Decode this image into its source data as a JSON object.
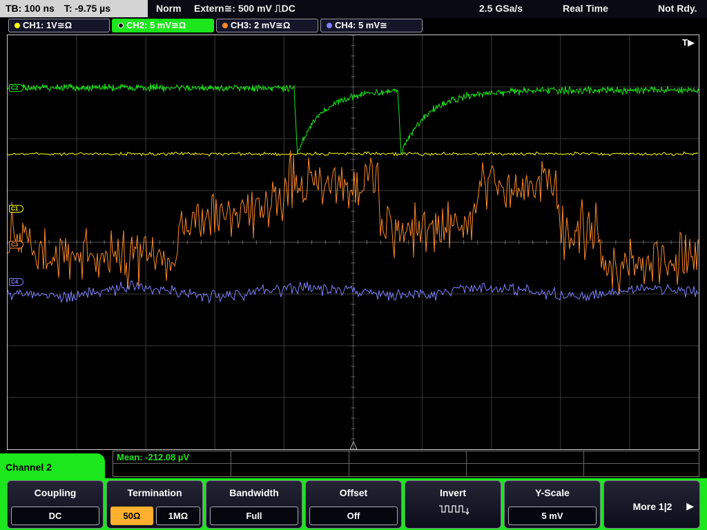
{
  "status": {
    "tb": "TB: 100 ns",
    "t": "T: -9.75 µs",
    "mode": "Norm",
    "trigger": "Extern≅: 500 mV ⎍DC",
    "sample_rate": "2.5 GSa/s",
    "acq": "Real Time",
    "state": "Not Rdy."
  },
  "channels": [
    {
      "label": "CH1: 1V≅Ω",
      "color": "#ffff00",
      "marker": "C1",
      "active": false
    },
    {
      "label": "CH2: 5 mV≅Ω",
      "color": "#1ce61c",
      "marker": "C2",
      "active": true
    },
    {
      "label": "CH3: 2 mV≅Ω",
      "color": "#ff8a2a",
      "marker": "C3",
      "active": false
    },
    {
      "label": "CH4: 5 mV≅",
      "color": "#8080ff",
      "marker": "C4",
      "active": false
    }
  ],
  "trigger_marker": "T▶",
  "measurement": "Mean: -212.08 µV",
  "channel_panel_title": "Channel 2",
  "softkeys": {
    "coupling": {
      "title": "Coupling",
      "value": "DC"
    },
    "termination": {
      "title": "Termination",
      "options": [
        "50Ω",
        "1MΩ"
      ],
      "selected": "50Ω"
    },
    "bandwidth": {
      "title": "Bandwidth",
      "value": "Full"
    },
    "offset": {
      "title": "Offset",
      "value": "Off"
    },
    "invert": {
      "title": "Invert",
      "icon": "invert-waveform-icon"
    },
    "y_scale": {
      "title": "Y-Scale",
      "value": "5 mV"
    },
    "more": {
      "label": "More 1|2"
    }
  },
  "icons": [
    "trigger-position-icon",
    "invert-waveform-icon",
    "next-page-icon",
    "trigger-level-icon"
  ]
}
